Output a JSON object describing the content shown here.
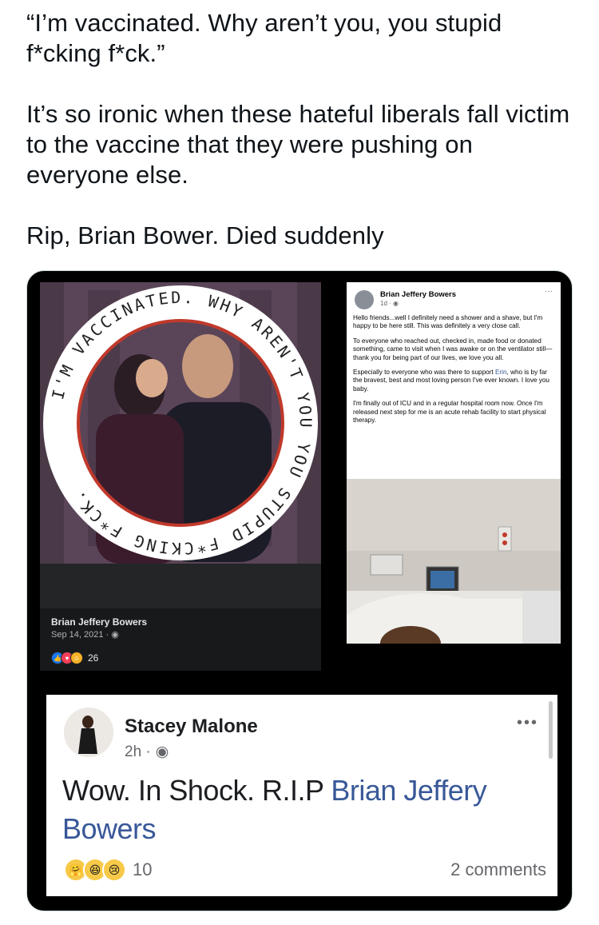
{
  "tweet": {
    "line1": "“I’m vaccinated. Why aren’t you, you stupid f*cking f*ck.”",
    "line2": "It’s so ironic when these hateful liberals fall victim to the vaccine that they were pushing on everyone else.",
    "line3": "Rip, Brian Bower. Died suddenly"
  },
  "left_post": {
    "ring_text": "I'M VACCINATED. WHY AREN'T YOU YOU STUPID F*CKING F*CK.",
    "author": "Brian Jeffery Bowers",
    "date": "Sep 14, 2021 · ",
    "reaction_count": "26"
  },
  "right_post": {
    "author": "Brian Jeffery Bowers",
    "time": "1d · ",
    "dots": "···",
    "p1": "Hello friends...well I definitely need a shower and a shave, but I'm happy to be here still. This was definitely a very close call.",
    "p2": "To everyone who reached out, checked in, made food or donated something, came to visit when I was awake or on the ventilator still—thank you for being part of our lives, we love you all.",
    "p3a": "Especially to everyone who was there to support ",
    "p3_link": "Erin",
    "p3b": ", who is by far the bravest, best and most loving person I've ever known. I love you baby.",
    "p4": "I'm finally out of ICU and in a regular hospital room now. Once I'm released next step for me is an acute rehab facility to start physical therapy."
  },
  "comment": {
    "name": "Stacey Malone",
    "time": "2h · ",
    "dots": "•••",
    "text_prefix": "Wow. In Shock. R.I.P ",
    "mention": "Brian Jeffery Bowers",
    "reaction_count": "10",
    "comments_label": "2 comments"
  },
  "colors": {
    "link": "#385898",
    "card_bg": "#000000"
  }
}
